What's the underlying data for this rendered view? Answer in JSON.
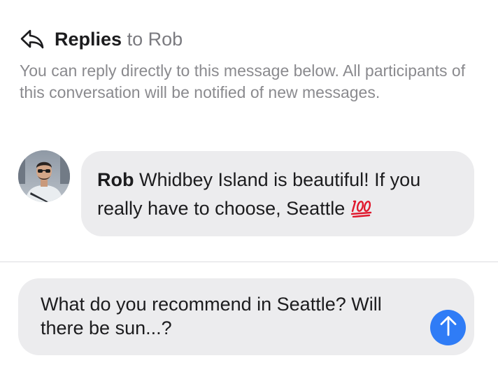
{
  "header": {
    "title_strong": "Replies",
    "title_rest": "to Rob",
    "icon": "reply-arrow-icon"
  },
  "intro": {
    "text": "You can reply directly to this message below. All participants of this conversation will be notified of new messages."
  },
  "message": {
    "sender": "Rob",
    "text": "Whidbey Island is beautiful! If you really have to choose, Seattle",
    "emoji": "hundred-points-emoji",
    "avatar": "user-avatar-photo"
  },
  "composer": {
    "value": "What do you recommend in Seattle? Will there be sun...?",
    "send_icon": "arrow-up-icon",
    "send_color": "#2f7cf6"
  },
  "colors": {
    "bubble": "#ececee",
    "secondary_text": "#8a8a8e",
    "divider": "#dcdce0"
  }
}
